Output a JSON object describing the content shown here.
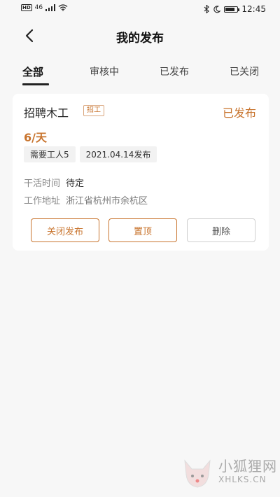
{
  "status_bar": {
    "network_badge": "HD",
    "signal_label": "46",
    "time": "12:45",
    "battery_level": 0.8
  },
  "header": {
    "title": "我的发布",
    "back_icon": "chevron-left-icon"
  },
  "tabs": [
    {
      "label": "全部",
      "active": true
    },
    {
      "label": "审核中",
      "active": false
    },
    {
      "label": "已发布",
      "active": false
    },
    {
      "label": "已关闭",
      "active": false
    }
  ],
  "post": {
    "title": "招聘木工",
    "tag": "招工",
    "status": "已发布",
    "wage": "6/天",
    "chips": [
      "需要工人5",
      "2021.04.14发布"
    ],
    "work_time_label": "干活时间",
    "work_time_value": "待定",
    "address_label": "工作地址",
    "address_value": "浙江省杭州市余杭区",
    "actions": {
      "close": "关闭发布",
      "pin": "置顶",
      "delete": "删除"
    }
  },
  "watermark": {
    "text_cn": "小狐狸网",
    "text_en": "XHLKS.CN"
  },
  "colors": {
    "accent": "#c8742e",
    "background": "#f7f7f7",
    "card": "#ffffff"
  }
}
